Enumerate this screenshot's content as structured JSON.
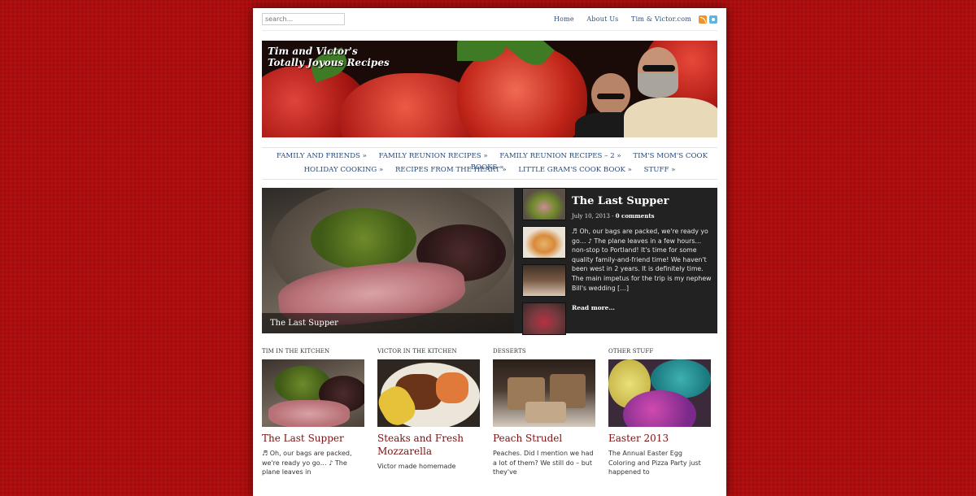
{
  "search": {
    "placeholder": "search..."
  },
  "top_links": [
    "Home",
    "About Us",
    "Tim & Victor.com"
  ],
  "icons": {
    "rss": "rss-icon",
    "twitter": "twitter-icon"
  },
  "banner": {
    "title_line1": "Tim and Victor's",
    "title_line2": "Totally Joyous Recipes"
  },
  "nav": {
    "row1": [
      "FAMILY AND FRIENDS »",
      "FAMILY REUNION RECIPES »",
      "FAMILY REUNION RECIPES – 2 »",
      "TIM'S MOM'S COOK BOOKS »"
    ],
    "row2": [
      "HOLIDAY COOKING »",
      "RECIPES FROM THE HEART »",
      "LITTLE GRAM'S COOK BOOK »",
      "STUFF »"
    ]
  },
  "featured": {
    "caption": "The Last Supper",
    "title": "The Last Supper",
    "date": "July 10, 2013",
    "sep": "-",
    "comments": "0 comments",
    "excerpt": "♬ Oh, our bags are packed, we're ready yo go… ♪ The plane leaves in a few hours… non-stop to Portland! It's time for some quality family-and-friend time! We haven't been west in 2 years. It is definitely time. The main impetus for the trip is my nephew Bill's wedding […]",
    "read_more": "Read more…"
  },
  "columns": [
    {
      "heading": "TIM IN THE KITCHEN",
      "title": "The Last Supper",
      "excerpt": "♬ Oh, our bags are packed, we're ready yo go… ♪ The plane leaves in"
    },
    {
      "heading": "VICTOR IN THE KITCHEN",
      "title": "Steaks and Fresh Mozzarella",
      "excerpt": "Victor made homemade"
    },
    {
      "heading": "DESSERTS",
      "title": "Peach Strudel",
      "excerpt": "Peaches. Did I mention we had a lot of them? We still do – but they've"
    },
    {
      "heading": "OTHER STUFF",
      "title": "Easter 2013",
      "excerpt": "The Annual Easter Egg Coloring and Pizza Party just happened to"
    }
  ],
  "colors": {
    "background": "#b30f10",
    "link": "#24497a",
    "title": "#7a1010"
  }
}
